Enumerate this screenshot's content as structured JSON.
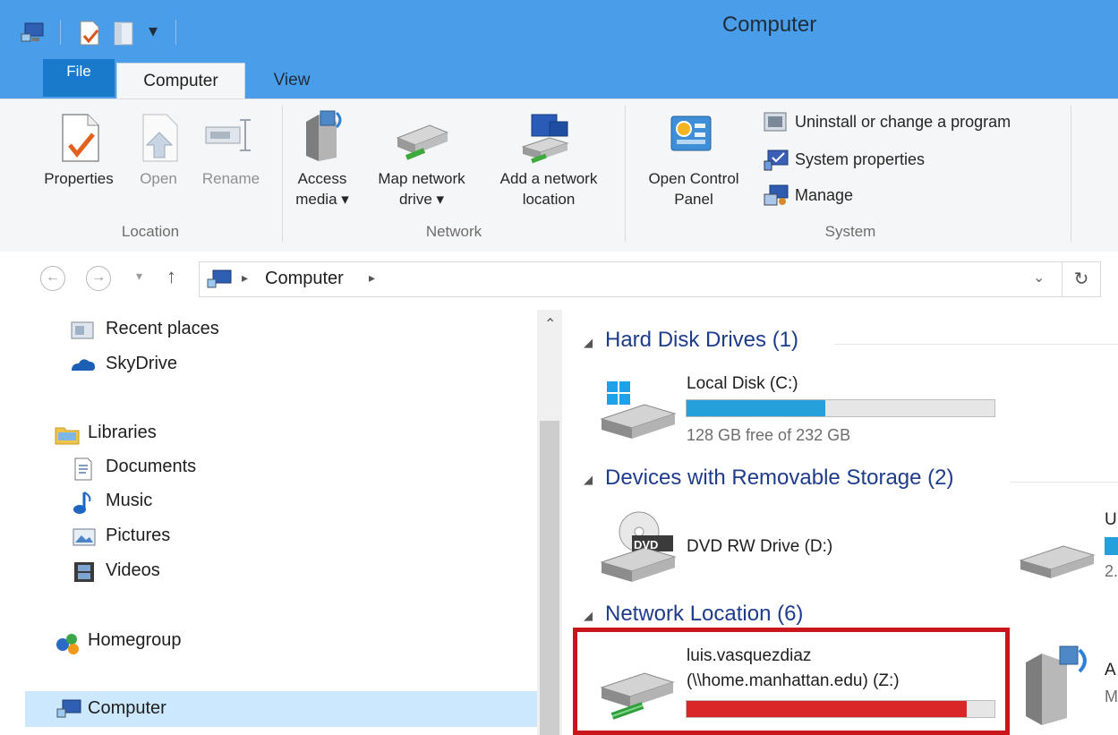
{
  "window": {
    "title": "Computer"
  },
  "tabs": {
    "file": "File",
    "computer": "Computer",
    "view": "View"
  },
  "ribbon": {
    "location": {
      "label": "Location",
      "properties": "Properties",
      "open": "Open",
      "rename": "Rename"
    },
    "network": {
      "label": "Network",
      "access_media_1": "Access",
      "access_media_2": "media ▾",
      "map_drive_1": "Map network",
      "map_drive_2": "drive ▾",
      "add_location_1": "Add a network",
      "add_location_2": "location"
    },
    "system": {
      "label": "System",
      "control_panel_1": "Open Control",
      "control_panel_2": "Panel",
      "uninstall": "Uninstall or change a program",
      "system_properties": "System properties",
      "manage": "Manage"
    }
  },
  "address": {
    "crumb": "Computer",
    "separator": "▸"
  },
  "nav_pane": {
    "recent_places": "Recent places",
    "skydrive": "SkyDrive",
    "libraries": "Libraries",
    "documents": "Documents",
    "music": "Music",
    "pictures": "Pictures",
    "videos": "Videos",
    "homegroup": "Homegroup",
    "computer": "Computer"
  },
  "content": {
    "hard_disk_header": "Hard Disk Drives (1)",
    "local_disk": {
      "name": "Local Disk (C:)",
      "free": "128 GB free of 232 GB",
      "used_fraction": 0.45,
      "color": "#26a0da"
    },
    "removable_header": "Devices with Removable Storage (2)",
    "dvd": {
      "name": "DVD RW Drive (D:)",
      "label": "DVD"
    },
    "usb_partial": {
      "name": "U",
      "sub": "2."
    },
    "network_header": "Network Location (6)",
    "network_drive": {
      "name_line1": "luis.vasquezdiaz",
      "name_line2": "(\\\\home.manhattan.edu) (Z:)",
      "used_fraction": 0.91,
      "color": "#da2626"
    },
    "partial_item": {
      "name": "A",
      "sub": "M"
    }
  },
  "colors": {
    "titlebar": "#4a9de8",
    "file_tab": "#1979ca",
    "highlight": "#c9161c"
  }
}
